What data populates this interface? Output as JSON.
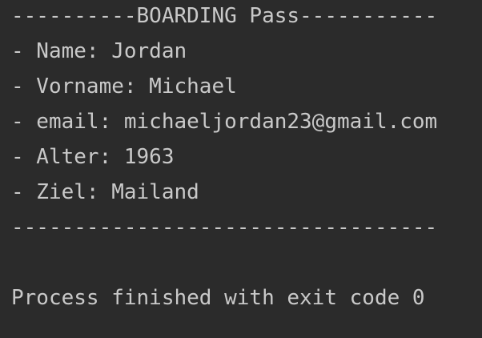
{
  "console": {
    "lines": [
      "----------BOARDING Pass-----------",
      "- Name: Jordan",
      "- Vorname: Michael",
      "- email: michaeljordan23@gmail.com",
      "- Alter: 1963",
      "- Ziel: Mailand",
      "----------------------------------"
    ],
    "exit_message": "Process finished with exit code 0"
  },
  "colors": {
    "background": "#2b2b2b",
    "text": "#c9c9c9"
  }
}
